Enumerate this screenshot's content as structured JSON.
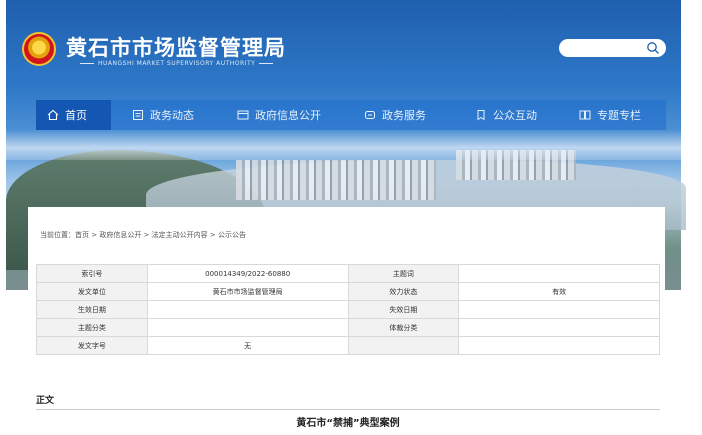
{
  "header": {
    "title": "黄石市市场监督管理局",
    "subtitle": "HUANGSHI MARKET SUPERVISORY AUTHORITY",
    "search": {
      "placeholder": ""
    }
  },
  "nav": {
    "items": [
      {
        "label": "首页",
        "icon": "home-icon",
        "active": true
      },
      {
        "label": "政务动态",
        "icon": "news-icon"
      },
      {
        "label": "政府信息公开",
        "icon": "info-icon"
      },
      {
        "label": "政务服务",
        "icon": "service-icon"
      },
      {
        "label": "公众互动",
        "icon": "interact-icon"
      },
      {
        "label": "专题专栏",
        "icon": "topic-icon"
      }
    ]
  },
  "breadcrumb": "当前位置：首页 > 政府信息公开 > 法定主动公开内容 > 公示公告",
  "meta": {
    "rows": [
      [
        "索引号",
        "000014349/2022-60880",
        "主题词",
        ""
      ],
      [
        "发文单位",
        "黄石市市场监督管理局",
        "效力状态",
        "有效"
      ],
      [
        "生效日期",
        "",
        "失效日期",
        ""
      ],
      [
        "主题分类",
        "",
        "体裁分类",
        ""
      ],
      [
        "发文字号",
        "无",
        "",
        ""
      ]
    ]
  },
  "content": {
    "body_label": "正文",
    "doc_title": "黄石市“禁捕”典型案例"
  },
  "colors": {
    "brand_blue": "#1f5fae",
    "nav_active": "#1457b2"
  }
}
